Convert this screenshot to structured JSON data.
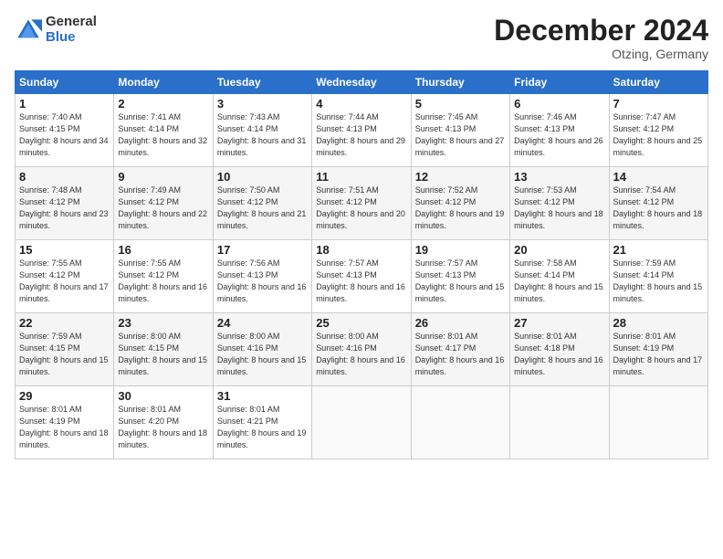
{
  "header": {
    "logo_general": "General",
    "logo_blue": "Blue",
    "title": "December 2024",
    "location": "Otzing, Germany"
  },
  "days_of_week": [
    "Sunday",
    "Monday",
    "Tuesday",
    "Wednesday",
    "Thursday",
    "Friday",
    "Saturday"
  ],
  "weeks": [
    [
      {
        "day": "1",
        "sunrise": "7:40 AM",
        "sunset": "4:15 PM",
        "daylight": "8 hours and 34 minutes."
      },
      {
        "day": "2",
        "sunrise": "7:41 AM",
        "sunset": "4:14 PM",
        "daylight": "8 hours and 32 minutes."
      },
      {
        "day": "3",
        "sunrise": "7:43 AM",
        "sunset": "4:14 PM",
        "daylight": "8 hours and 31 minutes."
      },
      {
        "day": "4",
        "sunrise": "7:44 AM",
        "sunset": "4:13 PM",
        "daylight": "8 hours and 29 minutes."
      },
      {
        "day": "5",
        "sunrise": "7:45 AM",
        "sunset": "4:13 PM",
        "daylight": "8 hours and 27 minutes."
      },
      {
        "day": "6",
        "sunrise": "7:46 AM",
        "sunset": "4:13 PM",
        "daylight": "8 hours and 26 minutes."
      },
      {
        "day": "7",
        "sunrise": "7:47 AM",
        "sunset": "4:12 PM",
        "daylight": "8 hours and 25 minutes."
      }
    ],
    [
      {
        "day": "8",
        "sunrise": "7:48 AM",
        "sunset": "4:12 PM",
        "daylight": "8 hours and 23 minutes."
      },
      {
        "day": "9",
        "sunrise": "7:49 AM",
        "sunset": "4:12 PM",
        "daylight": "8 hours and 22 minutes."
      },
      {
        "day": "10",
        "sunrise": "7:50 AM",
        "sunset": "4:12 PM",
        "daylight": "8 hours and 21 minutes."
      },
      {
        "day": "11",
        "sunrise": "7:51 AM",
        "sunset": "4:12 PM",
        "daylight": "8 hours and 20 minutes."
      },
      {
        "day": "12",
        "sunrise": "7:52 AM",
        "sunset": "4:12 PM",
        "daylight": "8 hours and 19 minutes."
      },
      {
        "day": "13",
        "sunrise": "7:53 AM",
        "sunset": "4:12 PM",
        "daylight": "8 hours and 18 minutes."
      },
      {
        "day": "14",
        "sunrise": "7:54 AM",
        "sunset": "4:12 PM",
        "daylight": "8 hours and 18 minutes."
      }
    ],
    [
      {
        "day": "15",
        "sunrise": "7:55 AM",
        "sunset": "4:12 PM",
        "daylight": "8 hours and 17 minutes."
      },
      {
        "day": "16",
        "sunrise": "7:55 AM",
        "sunset": "4:12 PM",
        "daylight": "8 hours and 16 minutes."
      },
      {
        "day": "17",
        "sunrise": "7:56 AM",
        "sunset": "4:13 PM",
        "daylight": "8 hours and 16 minutes."
      },
      {
        "day": "18",
        "sunrise": "7:57 AM",
        "sunset": "4:13 PM",
        "daylight": "8 hours and 16 minutes."
      },
      {
        "day": "19",
        "sunrise": "7:57 AM",
        "sunset": "4:13 PM",
        "daylight": "8 hours and 15 minutes."
      },
      {
        "day": "20",
        "sunrise": "7:58 AM",
        "sunset": "4:14 PM",
        "daylight": "8 hours and 15 minutes."
      },
      {
        "day": "21",
        "sunrise": "7:59 AM",
        "sunset": "4:14 PM",
        "daylight": "8 hours and 15 minutes."
      }
    ],
    [
      {
        "day": "22",
        "sunrise": "7:59 AM",
        "sunset": "4:15 PM",
        "daylight": "8 hours and 15 minutes."
      },
      {
        "day": "23",
        "sunrise": "8:00 AM",
        "sunset": "4:15 PM",
        "daylight": "8 hours and 15 minutes."
      },
      {
        "day": "24",
        "sunrise": "8:00 AM",
        "sunset": "4:16 PM",
        "daylight": "8 hours and 15 minutes."
      },
      {
        "day": "25",
        "sunrise": "8:00 AM",
        "sunset": "4:16 PM",
        "daylight": "8 hours and 16 minutes."
      },
      {
        "day": "26",
        "sunrise": "8:01 AM",
        "sunset": "4:17 PM",
        "daylight": "8 hours and 16 minutes."
      },
      {
        "day": "27",
        "sunrise": "8:01 AM",
        "sunset": "4:18 PM",
        "daylight": "8 hours and 16 minutes."
      },
      {
        "day": "28",
        "sunrise": "8:01 AM",
        "sunset": "4:19 PM",
        "daylight": "8 hours and 17 minutes."
      }
    ],
    [
      {
        "day": "29",
        "sunrise": "8:01 AM",
        "sunset": "4:19 PM",
        "daylight": "8 hours and 18 minutes."
      },
      {
        "day": "30",
        "sunrise": "8:01 AM",
        "sunset": "4:20 PM",
        "daylight": "8 hours and 18 minutes."
      },
      {
        "day": "31",
        "sunrise": "8:01 AM",
        "sunset": "4:21 PM",
        "daylight": "8 hours and 19 minutes."
      },
      null,
      null,
      null,
      null
    ]
  ]
}
